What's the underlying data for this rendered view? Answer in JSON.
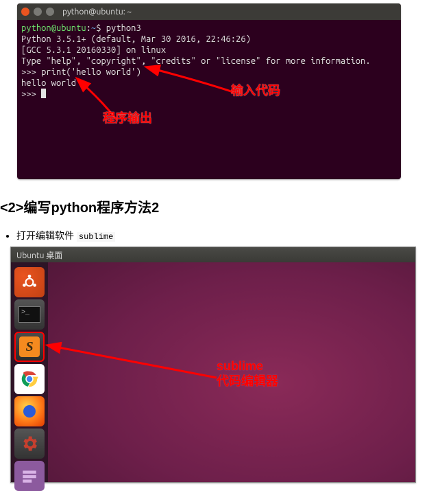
{
  "terminal": {
    "title": "python@ubuntu: ~",
    "prompt_user": "python@ubuntu",
    "prompt_sep": ":",
    "prompt_path": "~",
    "prompt_dollar": "$ ",
    "cmd": "python3",
    "line2": "Python 3.5.1+ (default, Mar 30 2016, 22:46:26)",
    "line3": "[GCC 5.3.1 20160330] on linux",
    "line4": "Type \"help\", \"copyright\", \"credits\" or \"license\" for more information.",
    "line5": ">>> print('hello world')",
    "line6": "hello world",
    "line7_prefix": ">>> "
  },
  "annotations": {
    "input_code": "输入代码",
    "program_output": "程序输出"
  },
  "section2_heading": "<2>编写python程序方法2",
  "bullet_text_prefix": "打开编辑软件 ",
  "bullet_code": "sublime",
  "ubuntu": {
    "titlebar": "Ubuntu 桌面",
    "launcher_items": [
      "dash",
      "terminal",
      "sublime",
      "chrome",
      "firefox",
      "settings",
      "files"
    ],
    "annotation_line1": "sublime",
    "annotation_line2": "代码编辑器"
  }
}
